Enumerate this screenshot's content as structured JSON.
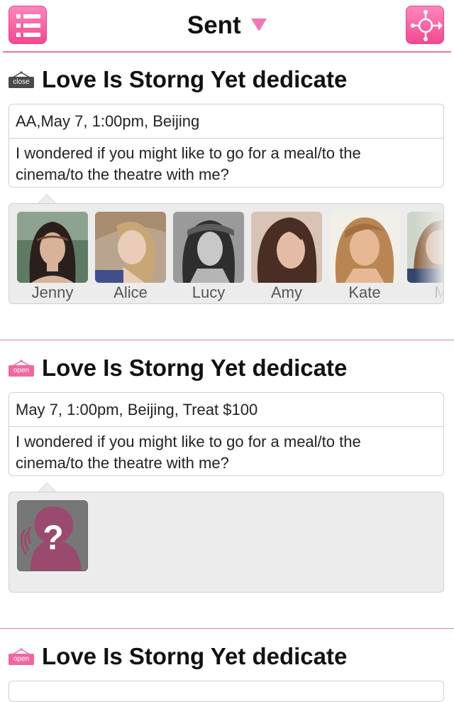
{
  "header": {
    "title": "Sent",
    "menu_icon": "list-icon",
    "share_icon": "network-share-icon",
    "accent_color": "#f14a91"
  },
  "cards": [
    {
      "status": "close",
      "title": "Love Is Storng Yet dedicate",
      "details": "AA,May 7, 1:00pm, Beijing",
      "message": "I wondered if you might like to go for a meal/to the cinema/to the theatre with me?",
      "recipients": [
        {
          "name": "Jenny"
        },
        {
          "name": "Alice"
        },
        {
          "name": "Lucy"
        },
        {
          "name": "Amy"
        },
        {
          "name": "Kate"
        },
        {
          "name": "Mi"
        }
      ]
    },
    {
      "status": "open",
      "title": "Love Is Storng Yet dedicate",
      "details": "May 7, 1:00pm, Beijing, Treat $100",
      "message": "I wondered if you might like to go for a meal/to the cinema/to the theatre with me?",
      "recipient_placeholder": "unknown-person-icon"
    },
    {
      "status": "open",
      "title": "Love Is Storng Yet dedicate"
    }
  ]
}
